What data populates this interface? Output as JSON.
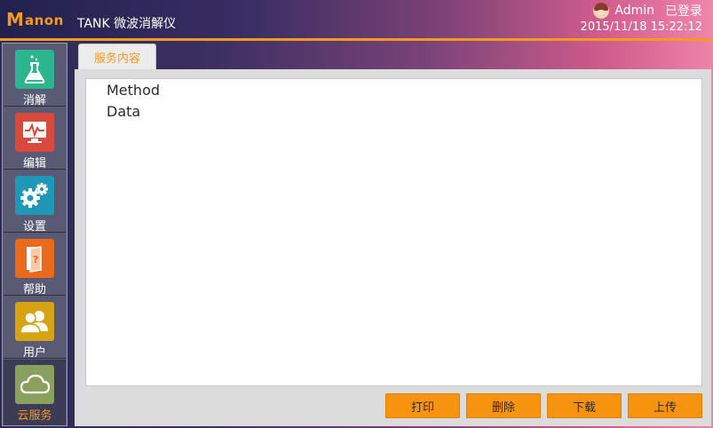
{
  "header": {
    "logo_text": "Manon",
    "app_title": "TANK 微波消解仪",
    "user_name": "Admin",
    "login_status": "已登录",
    "datetime": "2015/11/18 15:22:12",
    "accent_color": "#f59a20"
  },
  "sidebar": {
    "items": [
      {
        "label": "消解",
        "icon": "flask-icon",
        "color": "#2db58f"
      },
      {
        "label": "编辑",
        "icon": "monitor-pulse-icon",
        "color": "#d94a3c"
      },
      {
        "label": "设置",
        "icon": "gears-icon",
        "color": "#1f98b8"
      },
      {
        "label": "帮助",
        "icon": "help-book-icon",
        "color": "#e86a1a"
      },
      {
        "label": "用户",
        "icon": "users-icon",
        "color": "#d6a412"
      },
      {
        "label": "云服务",
        "icon": "cloud-icon",
        "color": "#8aa05e"
      }
    ],
    "active_index": 5
  },
  "main": {
    "tab_label": "服务内容",
    "list": [
      "Method",
      "Data"
    ],
    "buttons": {
      "print": "打印",
      "delete": "删除",
      "download": "下载",
      "upload": "上传"
    }
  }
}
